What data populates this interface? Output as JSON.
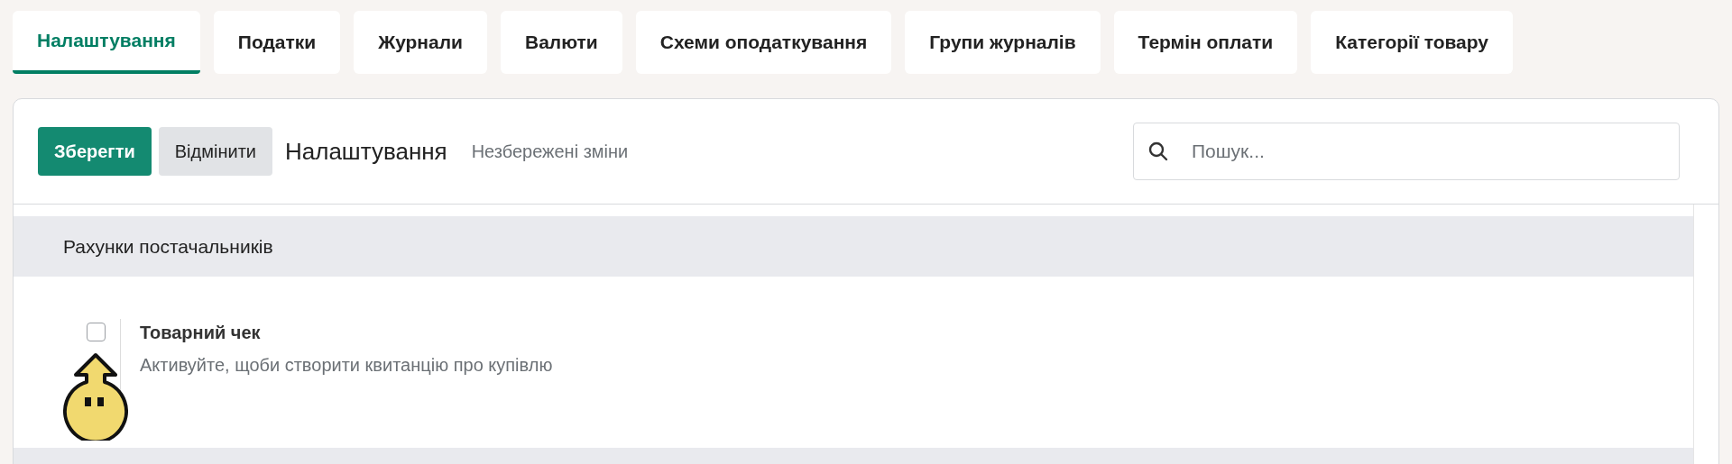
{
  "tabs": [
    {
      "label": "Налаштування",
      "selected": true
    },
    {
      "label": "Податки",
      "selected": false
    },
    {
      "label": "Журнали",
      "selected": false
    },
    {
      "label": "Валюти",
      "selected": false
    },
    {
      "label": "Схеми оподаткування",
      "selected": false
    },
    {
      "label": "Групи журналів",
      "selected": false
    },
    {
      "label": "Термін оплати",
      "selected": false
    },
    {
      "label": "Категорії товару",
      "selected": false
    }
  ],
  "toolbar": {
    "save": "Зберегти",
    "discard": "Відмінити",
    "title": "Налаштування",
    "status": "Незбережені зміни",
    "search": {
      "placeholder": "Пошук..."
    }
  },
  "sections": [
    {
      "title": "Рахунки постачальників",
      "settings": [
        {
          "label": "Товарний чек",
          "description": "Активуйте, щоби створити квитанцію про купівлю",
          "checked": false
        }
      ]
    }
  ]
}
